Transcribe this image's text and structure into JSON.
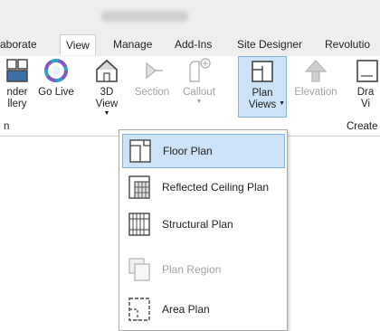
{
  "tabs": [
    "aborate",
    "View",
    "Manage",
    "Add-Ins",
    "Site Designer",
    "Revolutio"
  ],
  "active_tab": "View",
  "ribbon": {
    "render_gallery": "nder\nllery",
    "go_live": "Go Live",
    "view_3d": "3D\nView",
    "section": "Section",
    "callout": "Callout",
    "plan_views": "Plan\nViews",
    "elevation": "Elevation",
    "drafting_view": "Dra\nVi",
    "panel_left": "n",
    "panel_create": "Create"
  },
  "dropdown": {
    "items": [
      {
        "label": "Floor Plan",
        "icon": "floor-plan-icon",
        "state": "highlighted"
      },
      {
        "label": "Reflected Ceiling Plan",
        "icon": "reflected-ceiling-plan-icon",
        "state": "enabled"
      },
      {
        "label": "Structural Plan",
        "icon": "structural-plan-icon",
        "state": "enabled"
      },
      {
        "label": "Plan Region",
        "icon": "plan-region-icon",
        "state": "disabled"
      },
      {
        "label": "Area Plan",
        "icon": "area-plan-icon",
        "state": "enabled"
      }
    ]
  },
  "colors": {
    "highlight_bg": "#cde3f7",
    "highlight_border": "#7eb4ea",
    "disabled_text": "#a3a3a3",
    "ribbon_bg": "#ffffff",
    "tab_bar_bg": "#eeeeee"
  }
}
